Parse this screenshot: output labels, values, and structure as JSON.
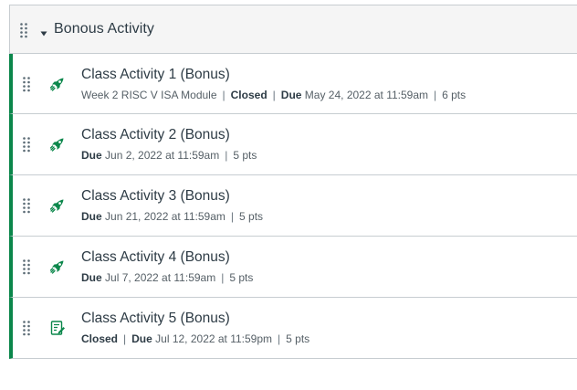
{
  "module": {
    "title": "Bonous Activity",
    "items": [
      {
        "title": "Class Activity 1 (Bonus)",
        "icon": "rocket-icon",
        "module_label": "Week 2 RISC V ISA Module",
        "status": "Closed",
        "due_label": "Due",
        "due_date": "May 24, 2022 at 11:59am",
        "points": "6 pts"
      },
      {
        "title": "Class Activity 2 (Bonus)",
        "icon": "rocket-icon",
        "due_label": "Due",
        "due_date": "Jun 2, 2022 at 11:59am",
        "points": "5 pts"
      },
      {
        "title": "Class Activity 3 (Bonus)",
        "icon": "rocket-icon",
        "due_label": "Due",
        "due_date": "Jun 21, 2022 at 11:59am",
        "points": "5 pts"
      },
      {
        "title": "Class Activity 4 (Bonus)",
        "icon": "rocket-icon",
        "due_label": "Due",
        "due_date": "Jul 7, 2022 at 11:59am",
        "points": "5 pts"
      },
      {
        "title": "Class Activity 5 (Bonus)",
        "icon": "quiz-icon",
        "status": "Closed",
        "due_label": "Due",
        "due_date": "Jul 12, 2022 at 11:59pm",
        "points": "5 pts"
      }
    ]
  },
  "colors": {
    "accent": "#0b874b",
    "text": "#2d3b45",
    "header_bg": "#f5f5f5"
  }
}
